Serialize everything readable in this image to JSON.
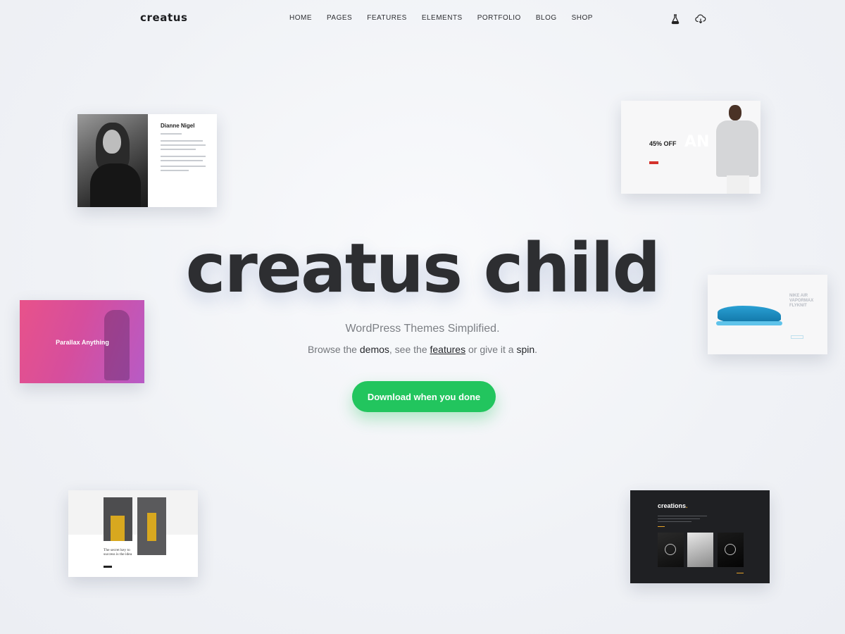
{
  "header": {
    "logo": "creatus",
    "nav": [
      "HOME",
      "PAGES",
      "FEATURES",
      "ELEMENTS",
      "PORTFOLIO",
      "BLOG",
      "SHOP"
    ],
    "icons": [
      "flask-icon",
      "cloud-download-icon"
    ]
  },
  "hero": {
    "title": "creatus child",
    "subtitle": "WordPress Themes Simplified.",
    "line": {
      "browse": "Browse the ",
      "demos": "demos",
      "see": ", see the ",
      "features": "features",
      "give": " or give it a ",
      "spin": "spin",
      "end": "."
    },
    "cta": "Download when you done"
  },
  "cards": {
    "profile": {
      "name": "Dianne Nigel"
    },
    "sale": {
      "offer": "45% OFF",
      "ghost": "AN"
    },
    "parallax": {
      "title": "Parallax Anything"
    },
    "shoe": {
      "title": "NIKE AIR VAPORMAX FLYKNIT"
    },
    "fashion": {
      "text": "The secret key to success is the idea"
    },
    "portfolio": {
      "title": "creations",
      "dot": "."
    }
  },
  "colors": {
    "cta": "#22c55e",
    "accent_orange": "#e6a228",
    "parallax_gradient": [
      "#e8528a",
      "#b75bc6"
    ],
    "text_dark": "#2d2e31"
  }
}
